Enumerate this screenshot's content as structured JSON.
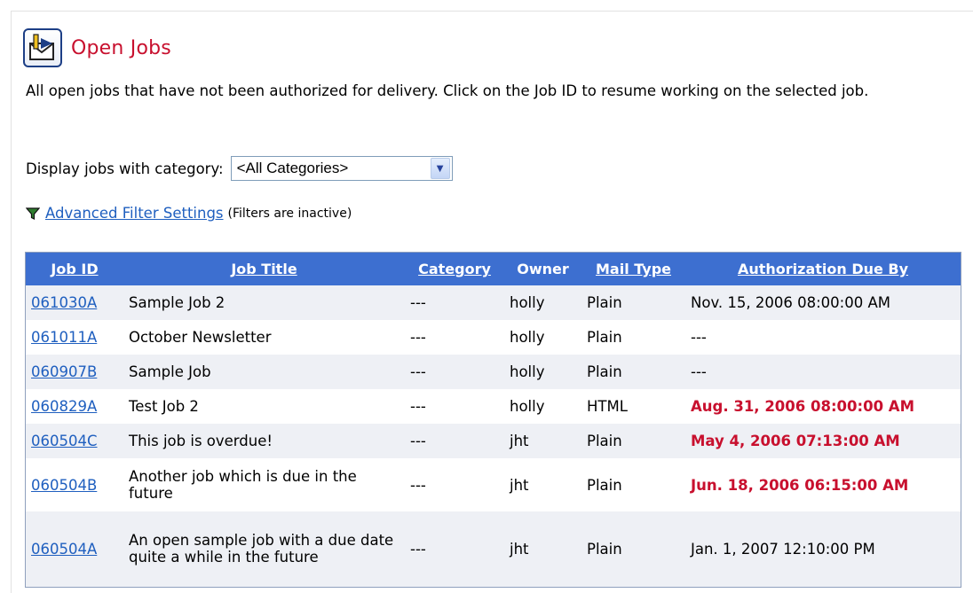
{
  "page": {
    "title": "Open Jobs",
    "icon": "open-jobs-envelope-icon",
    "intro": "All open jobs that have not been authorized for delivery. Click on the Job ID to resume working on the selected job."
  },
  "filter": {
    "label": "Display jobs with category:",
    "selected": "<All Categories>"
  },
  "advanced": {
    "link": "Advanced Filter Settings",
    "note": "(Filters are inactive)"
  },
  "table": {
    "headers": [
      "Job ID",
      "Job Title",
      "Category",
      "Owner",
      "Mail Type",
      "Authorization Due By"
    ],
    "rows": [
      {
        "id": "061030A",
        "title": "Sample Job 2",
        "category": "---",
        "owner": "holly",
        "mail": "Plain",
        "due": "Nov. 15, 2006 08:00:00 AM",
        "overdue": false
      },
      {
        "id": "061011A",
        "title": "October Newsletter",
        "category": "---",
        "owner": "holly",
        "mail": "Plain",
        "due": "---",
        "overdue": false
      },
      {
        "id": "060907B",
        "title": "Sample Job",
        "category": "---",
        "owner": "holly",
        "mail": "Plain",
        "due": "---",
        "overdue": false
      },
      {
        "id": "060829A",
        "title": "Test Job 2",
        "category": "---",
        "owner": "holly",
        "mail": "HTML",
        "due": "Aug. 31, 2006 08:00:00 AM",
        "overdue": true
      },
      {
        "id": "060504C",
        "title": "This job is overdue!",
        "category": "---",
        "owner": "jht",
        "mail": "Plain",
        "due": "May 4, 2006 07:13:00 AM",
        "overdue": true
      },
      {
        "id": "060504B",
        "title": "Another job which is due in the future",
        "category": "---",
        "owner": "jht",
        "mail": "Plain",
        "due": "Jun. 18, 2006 06:15:00 AM",
        "overdue": true
      },
      {
        "id": "060504A",
        "title": "An open sample job with a due date quite a while in the future",
        "category": "---",
        "owner": "jht",
        "mail": "Plain",
        "due": "Jan. 1, 2007 12:10:00 PM",
        "overdue": false
      }
    ]
  },
  "colors": {
    "title": "#c8102e",
    "header_bg": "#3d6fd0",
    "link": "#1f5fbf",
    "overdue": "#c8102e",
    "row_alt": "#eef0f5"
  }
}
